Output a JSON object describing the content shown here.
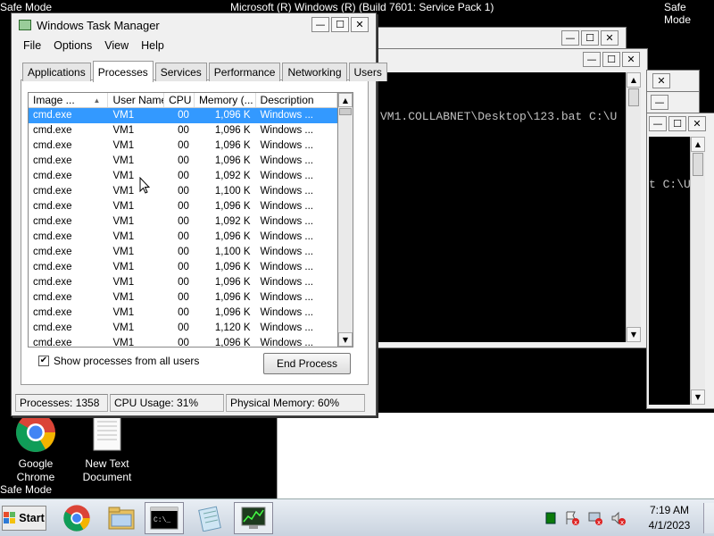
{
  "desktop": {
    "top_left": "Safe Mode",
    "top_center": "Microsoft (R) Windows (R) (Build 7601: Service Pack 1)",
    "top_right": "Safe Mode",
    "bottom_left": "Safe Mode",
    "icons": [
      {
        "label_line1": "Google",
        "label_line2": "Chrome",
        "icon": "chrome-icon"
      },
      {
        "label_line1": "New Text",
        "label_line2": "Document",
        "icon": "text-document-icon"
      }
    ]
  },
  "console_windows": [
    {
      "text": ""
    },
    {
      "text": "VM1.COLLABNET\\Desktop\\123.bat C:\\U"
    },
    {
      "text": ""
    },
    {
      "text": "t C:\\U"
    }
  ],
  "task_manager": {
    "title": "Windows Task Manager",
    "controls": {
      "minimize": "—",
      "maximize": "☐",
      "close": "✕"
    },
    "menu": [
      "File",
      "Options",
      "View",
      "Help"
    ],
    "tabs": [
      {
        "label": "Applications",
        "active": false
      },
      {
        "label": "Processes",
        "active": true
      },
      {
        "label": "Services",
        "active": false
      },
      {
        "label": "Performance",
        "active": false
      },
      {
        "label": "Networking",
        "active": false
      },
      {
        "label": "Users",
        "active": false
      }
    ],
    "columns": [
      "Image ...",
      "User Name",
      "CPU",
      "Memory (...",
      "Description"
    ],
    "rows": [
      {
        "image": "cmd.exe",
        "user": "VM1",
        "cpu": "00",
        "mem": "1,096 K",
        "desc": "Windows ...",
        "selected": true
      },
      {
        "image": "cmd.exe",
        "user": "VM1",
        "cpu": "00",
        "mem": "1,096 K",
        "desc": "Windows ..."
      },
      {
        "image": "cmd.exe",
        "user": "VM1",
        "cpu": "00",
        "mem": "1,096 K",
        "desc": "Windows ..."
      },
      {
        "image": "cmd.exe",
        "user": "VM1",
        "cpu": "00",
        "mem": "1,096 K",
        "desc": "Windows ..."
      },
      {
        "image": "cmd.exe",
        "user": "VM1",
        "cpu": "00",
        "mem": "1,092 K",
        "desc": "Windows ..."
      },
      {
        "image": "cmd.exe",
        "user": "VM1",
        "cpu": "00",
        "mem": "1,100 K",
        "desc": "Windows ..."
      },
      {
        "image": "cmd.exe",
        "user": "VM1",
        "cpu": "00",
        "mem": "1,096 K",
        "desc": "Windows ..."
      },
      {
        "image": "cmd.exe",
        "user": "VM1",
        "cpu": "00",
        "mem": "1,092 K",
        "desc": "Windows ..."
      },
      {
        "image": "cmd.exe",
        "user": "VM1",
        "cpu": "00",
        "mem": "1,096 K",
        "desc": "Windows ..."
      },
      {
        "image": "cmd.exe",
        "user": "VM1",
        "cpu": "00",
        "mem": "1,100 K",
        "desc": "Windows ..."
      },
      {
        "image": "cmd.exe",
        "user": "VM1",
        "cpu": "00",
        "mem": "1,096 K",
        "desc": "Windows ..."
      },
      {
        "image": "cmd.exe",
        "user": "VM1",
        "cpu": "00",
        "mem": "1,096 K",
        "desc": "Windows ..."
      },
      {
        "image": "cmd.exe",
        "user": "VM1",
        "cpu": "00",
        "mem": "1,096 K",
        "desc": "Windows ..."
      },
      {
        "image": "cmd.exe",
        "user": "VM1",
        "cpu": "00",
        "mem": "1,096 K",
        "desc": "Windows ..."
      },
      {
        "image": "cmd.exe",
        "user": "VM1",
        "cpu": "00",
        "mem": "1,120 K",
        "desc": "Windows ..."
      },
      {
        "image": "cmd.exe",
        "user": "VM1",
        "cpu": "00",
        "mem": "1,096 K",
        "desc": "Windows ..."
      }
    ],
    "show_all_label": "Show processes from all users",
    "show_all_checked": true,
    "end_process_label": "End Process",
    "status": {
      "processes": "Processes: 1358",
      "cpu": "CPU Usage: 31%",
      "memory": "Physical Memory: 60%"
    }
  },
  "taskbar": {
    "start_label": "Start",
    "apps": [
      "chrome-icon",
      "explorer-icon",
      "cmd-icon",
      "notepad-icon",
      "task-manager-icon"
    ],
    "clock_time": "7:19 AM",
    "clock_date": "4/1/2023"
  }
}
